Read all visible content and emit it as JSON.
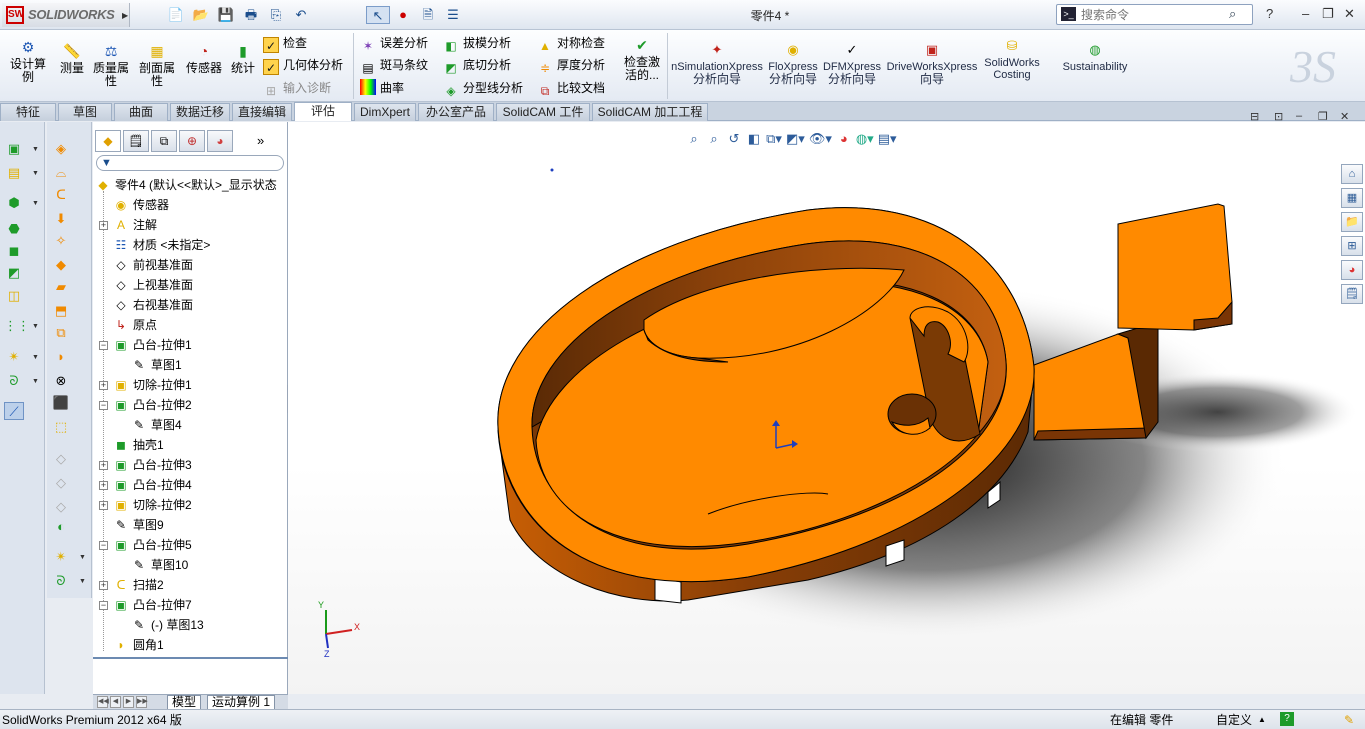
{
  "titlebar": {
    "app_name": "SOLIDWORKS",
    "doc_title": "零件4 *",
    "search_placeholder": "搜索命令",
    "help": "?",
    "minimize": "–",
    "restore": "❐",
    "close": "✕"
  },
  "commands": {
    "design_study": "设计算例",
    "measure": "测量",
    "mass_props": "质量属性",
    "section_props": "剖面属性",
    "sensor": "传感器",
    "statistics": "统计",
    "check": "检查",
    "geometry_analysis": "几何体分析",
    "import_diagnostics": "输入诊断",
    "deviation_analysis": "误差分析",
    "zebra_stripes": "斑马条纹",
    "curvature": "曲率",
    "draft_analysis": "拔模分析",
    "undercut_analysis": "底切分析",
    "parting_line_analysis": "分型线分析",
    "symmetry_check": "对称检查",
    "thickness_analysis": "厚度分析",
    "compare_documents": "比较文档",
    "check_active": "检查激活的...",
    "simulationxpress_1": "nSimulationXpress",
    "simulationxpress_2": "分析向导",
    "floxpress_1": "FloXpress",
    "floxpress_2": "分析向导",
    "dfmxpress_1": "DFMXpress",
    "dfmxpress_2": "分析向导",
    "driveworksxpress_1": "DriveWorksXpress",
    "driveworksxpress_2": "向导",
    "costing_1": "SolidWorks",
    "costing_2": "Costing",
    "sustainability": "Sustainability"
  },
  "tabs": [
    "特征",
    "草图",
    "曲面",
    "数据迁移",
    "直接编辑",
    "评估",
    "DimXpert",
    "办公室产品",
    "SolidCAM 工件",
    "SolidCAM 加工工程"
  ],
  "feature_tree": {
    "root": "零件4 (默认<<默认>_显示状态",
    "items": [
      {
        "label": "传感器"
      },
      {
        "label": "注解"
      },
      {
        "label": "材质 <未指定>"
      },
      {
        "label": "前视基准面"
      },
      {
        "label": "上视基准面"
      },
      {
        "label": "右视基准面"
      },
      {
        "label": "原点"
      },
      {
        "label": "凸台-拉伸1"
      },
      {
        "label": "草图1"
      },
      {
        "label": "切除-拉伸1"
      },
      {
        "label": "凸台-拉伸2"
      },
      {
        "label": "草图4"
      },
      {
        "label": "抽壳1"
      },
      {
        "label": "凸台-拉伸3"
      },
      {
        "label": "凸台-拉伸4"
      },
      {
        "label": "切除-拉伸2"
      },
      {
        "label": "草图9"
      },
      {
        "label": "凸台-拉伸5"
      },
      {
        "label": "草图10"
      },
      {
        "label": "扫描2"
      },
      {
        "label": "凸台-拉伸7"
      },
      {
        "label": "(-) 草图13"
      },
      {
        "label": "圆角1"
      }
    ]
  },
  "bottom_tabs": [
    "模型",
    "运动算例 1"
  ],
  "triad": {
    "x": "X",
    "y": "Y",
    "z": "Z"
  },
  "status": {
    "version": "SolidWorks Premium 2012 x64 版",
    "mode": "在编辑 零件",
    "units": "自定义",
    "help": "?"
  },
  "colors": {
    "part": "#ff8c00",
    "part_dark": "#7a3a05",
    "accent": "#1d57b4"
  }
}
